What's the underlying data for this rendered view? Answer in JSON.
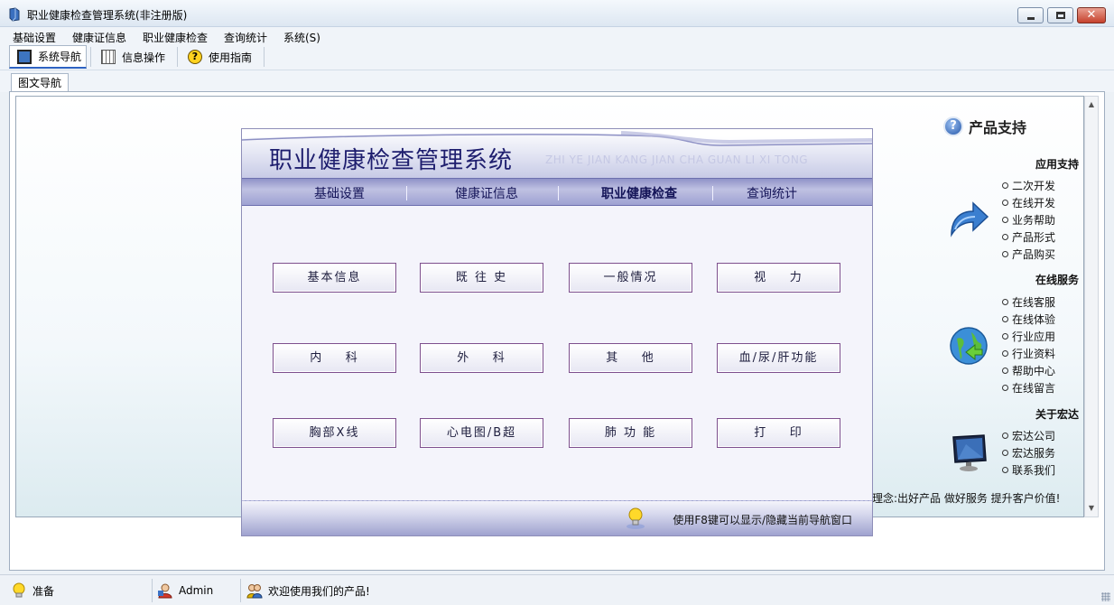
{
  "window": {
    "title": "职业健康检查管理系统(非注册版)",
    "close_glyph": "✕"
  },
  "menu": [
    "基础设置",
    "健康证信息",
    "职业健康检查",
    "查询统计",
    "系统(S)"
  ],
  "toolbar": [
    {
      "label": "系统导航",
      "icon": "monitor-icon",
      "active": true
    },
    {
      "label": "信息操作",
      "icon": "grid-icon",
      "active": false
    },
    {
      "label": "使用指南",
      "icon": "help-icon",
      "active": false
    }
  ],
  "doc_tab": "图文导航",
  "nav_panel": {
    "title": "职业健康检查管理系统",
    "subtitle": "ZHI YE JIAN KANG JIAN CHA GUAN LI XI TONG",
    "tabs": [
      "基础设置",
      "健康证信息",
      "职业健康检查",
      "查询统计"
    ],
    "active_tab": "职业健康检查",
    "buttons": [
      [
        "基本信息",
        "既 往 史",
        "一般情况",
        "视    力"
      ],
      [
        "内    科",
        "外    科",
        "其    他",
        "血/尿/肝功能"
      ],
      [
        "胸部X线",
        "心电图/B超",
        "肺 功 能",
        "打    印"
      ]
    ],
    "footer_hint": "使用F8键可以显示/隐藏当前导航窗口"
  },
  "support": {
    "title": "产品支持",
    "sections": [
      {
        "title": "应用支持",
        "icon": "arrow-icon",
        "links": [
          "二次开发",
          "在线开发",
          "业务帮助",
          "产品形式",
          "产品购买"
        ]
      },
      {
        "title": "在线服务",
        "icon": "globe-icon",
        "links": [
          "在线客服",
          "在线体验",
          "行业应用",
          "行业资料",
          "帮助中心",
          "在线留言"
        ]
      },
      {
        "title": "关于宏达",
        "icon": "monitor-icon",
        "links": [
          "宏达公司",
          "宏达服务",
          "联系我们"
        ]
      }
    ],
    "motto": "理念:出好产品 做好服务 提升客户价值!"
  },
  "status": {
    "state": "准备",
    "user": "Admin",
    "message": "欢迎使用我们的产品!"
  },
  "colors": {
    "nav_title": "#1e1e6e",
    "nav_tab_bar": "#9ea1d2",
    "button_border": "#7d4f8d"
  }
}
